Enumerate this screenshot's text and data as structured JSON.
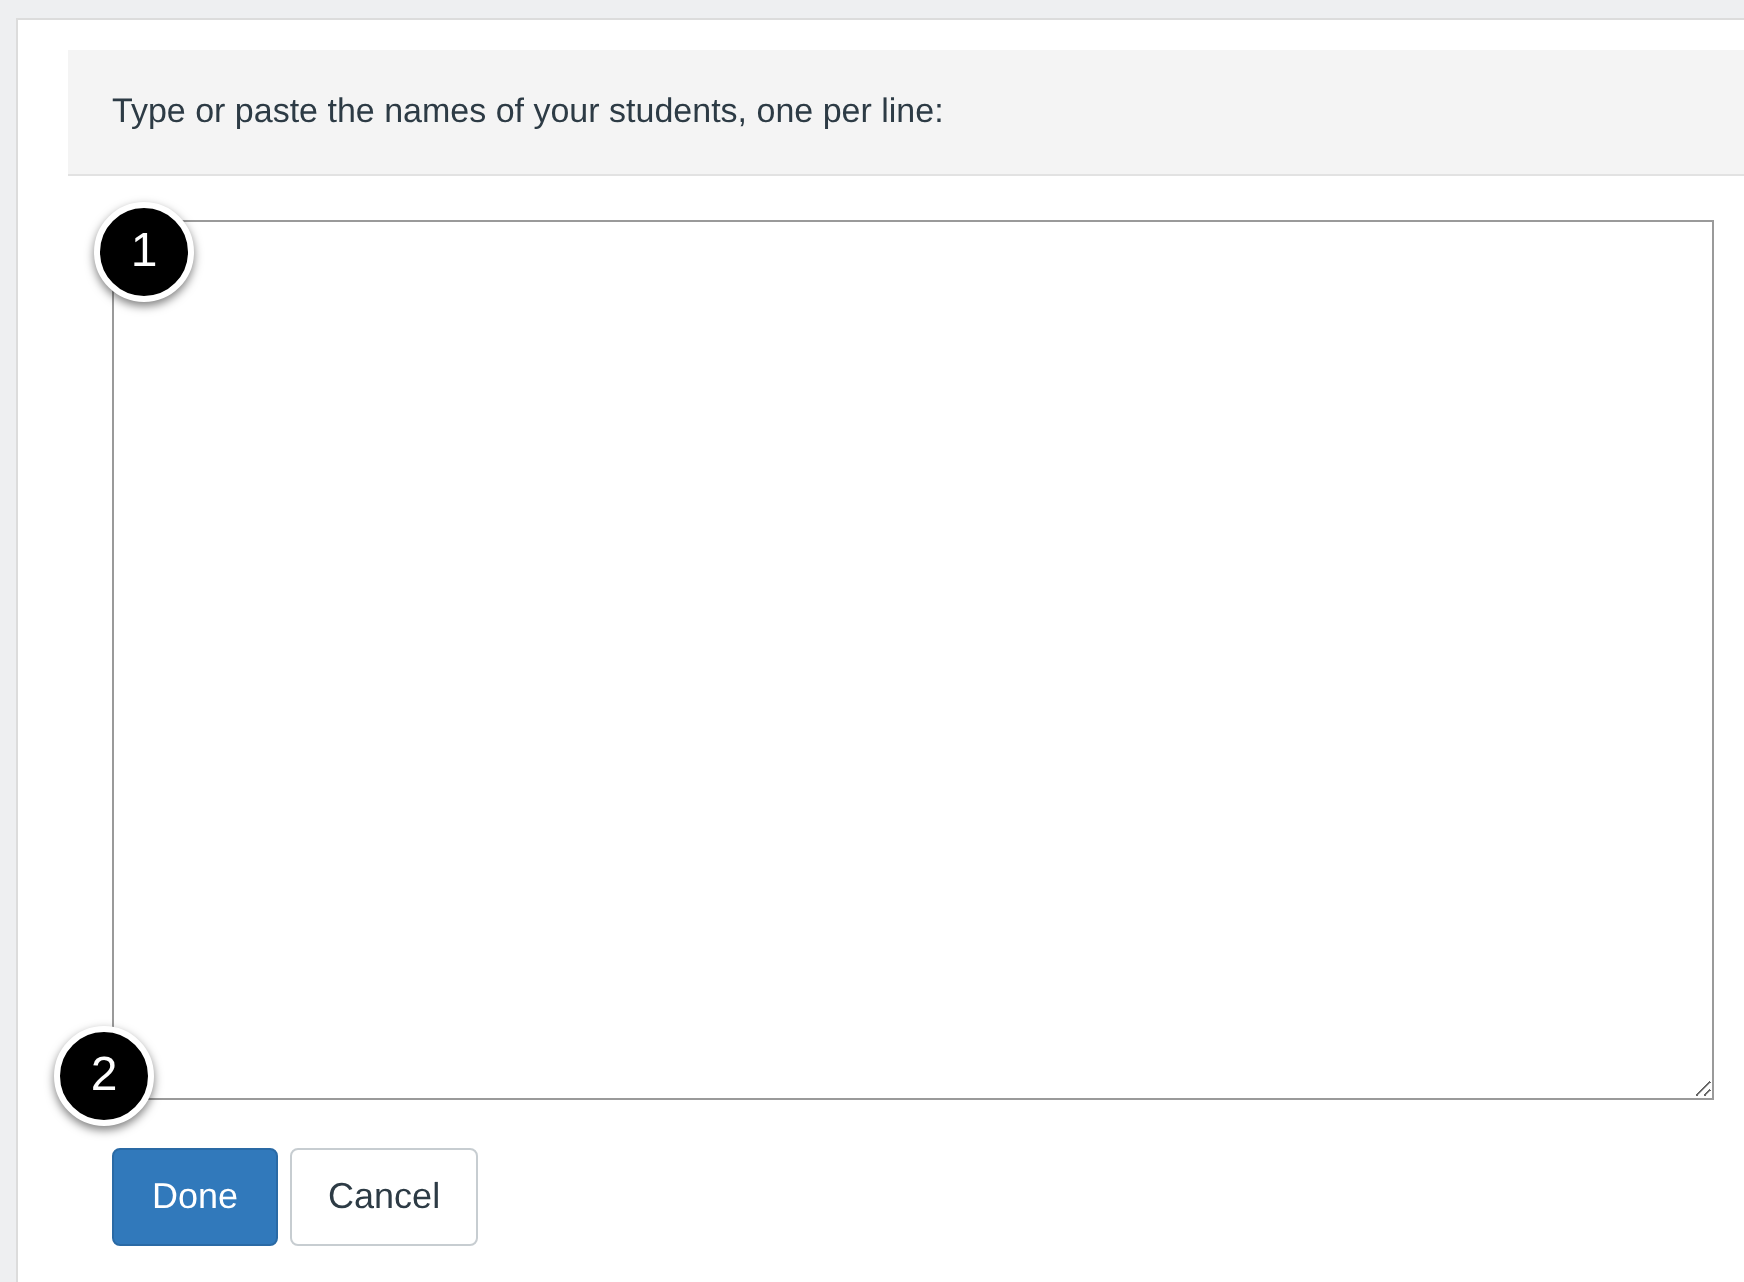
{
  "prompt": "Type or paste the names of your students, one per line:",
  "callouts": [
    "1",
    "2"
  ],
  "buttons": [
    {
      "label": "Done",
      "kind": "primary"
    },
    {
      "label": "Cancel",
      "kind": "secondary"
    }
  ]
}
